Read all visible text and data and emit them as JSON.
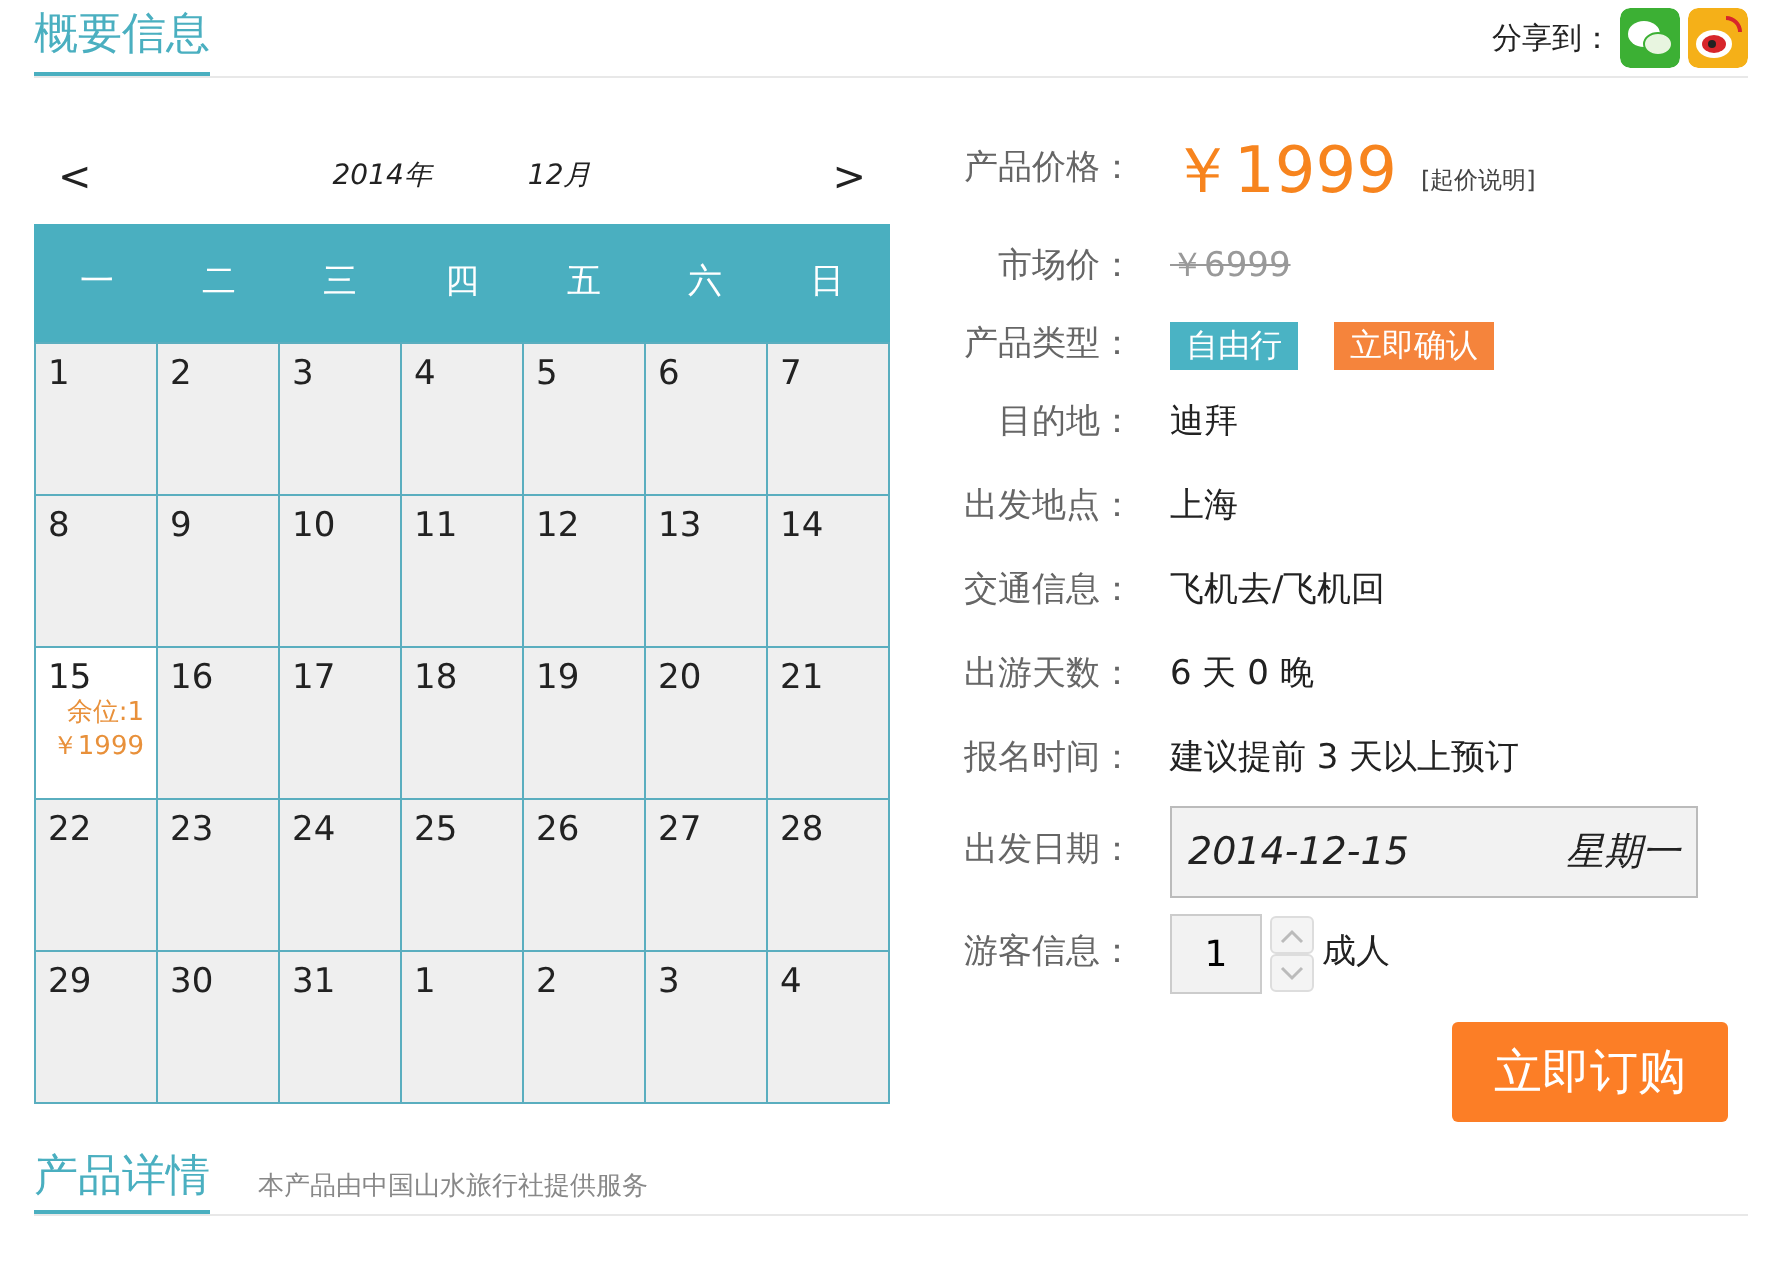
{
  "header": {
    "title": "概要信息",
    "share_label": "分享到："
  },
  "calendar": {
    "prev": "<",
    "next": ">",
    "year": "2014年",
    "month": "12月",
    "weekdays": [
      "一",
      "二",
      "三",
      "四",
      "五",
      "六",
      "日"
    ],
    "weeks": [
      [
        {
          "day": "1",
          "selected": false
        },
        {
          "day": "2",
          "selected": false
        },
        {
          "day": "3",
          "selected": false
        },
        {
          "day": "4",
          "selected": false
        },
        {
          "day": "5",
          "selected": false
        },
        {
          "day": "6",
          "selected": false
        },
        {
          "day": "7",
          "selected": false
        }
      ],
      [
        {
          "day": "8",
          "selected": false
        },
        {
          "day": "9",
          "selected": false
        },
        {
          "day": "10",
          "selected": false
        },
        {
          "day": "11",
          "selected": false
        },
        {
          "day": "12",
          "selected": false
        },
        {
          "day": "13",
          "selected": false
        },
        {
          "day": "14",
          "selected": false
        }
      ],
      [
        {
          "day": "15",
          "selected": true,
          "seats": "余位:1",
          "price": "￥1999"
        },
        {
          "day": "16",
          "selected": false
        },
        {
          "day": "17",
          "selected": false
        },
        {
          "day": "18",
          "selected": false
        },
        {
          "day": "19",
          "selected": false
        },
        {
          "day": "20",
          "selected": false
        },
        {
          "day": "21",
          "selected": false
        }
      ],
      [
        {
          "day": "22",
          "selected": false
        },
        {
          "day": "23",
          "selected": false
        },
        {
          "day": "24",
          "selected": false
        },
        {
          "day": "25",
          "selected": false
        },
        {
          "day": "26",
          "selected": false
        },
        {
          "day": "27",
          "selected": false
        },
        {
          "day": "28",
          "selected": false
        }
      ],
      [
        {
          "day": "29",
          "selected": false
        },
        {
          "day": "30",
          "selected": false
        },
        {
          "day": "31",
          "selected": false
        },
        {
          "day": "1",
          "selected": false
        },
        {
          "day": "2",
          "selected": false
        },
        {
          "day": "3",
          "selected": false
        },
        {
          "day": "4",
          "selected": false
        }
      ]
    ]
  },
  "details": [
    {
      "kind": "price",
      "label": "产品价格：",
      "value": "￥1999",
      "note": "[起价说明]"
    },
    {
      "kind": "strike",
      "label": "市场价：",
      "value": "￥6999"
    },
    {
      "kind": "tags",
      "label": "产品类型：",
      "tags": [
        {
          "text": "自由行",
          "color": "#4ab3c4"
        },
        {
          "text": "立即确认",
          "color": "#f5843c"
        }
      ]
    },
    {
      "kind": "text",
      "label": "目的地：",
      "value": "迪拜"
    },
    {
      "kind": "text",
      "label": "出发地点：",
      "value": "上海"
    },
    {
      "kind": "text",
      "label": "交通信息：",
      "value": "飞机去/飞机回"
    },
    {
      "kind": "text",
      "label": "出游天数：",
      "value": "6 天 0 晚"
    },
    {
      "kind": "text",
      "label": "报名时间：",
      "value": "建议提前 3 天以上预订"
    },
    {
      "kind": "date",
      "label": "出发日期：",
      "value": "2014-12-15",
      "weekday": "星期一"
    },
    {
      "kind": "stepper",
      "label": "游客信息：",
      "value": "1",
      "unit": "成人"
    }
  ],
  "buy_button": "立即订购",
  "footer": {
    "title": "产品详情",
    "subtitle": "本产品由中国山水旅行社提供服务"
  }
}
